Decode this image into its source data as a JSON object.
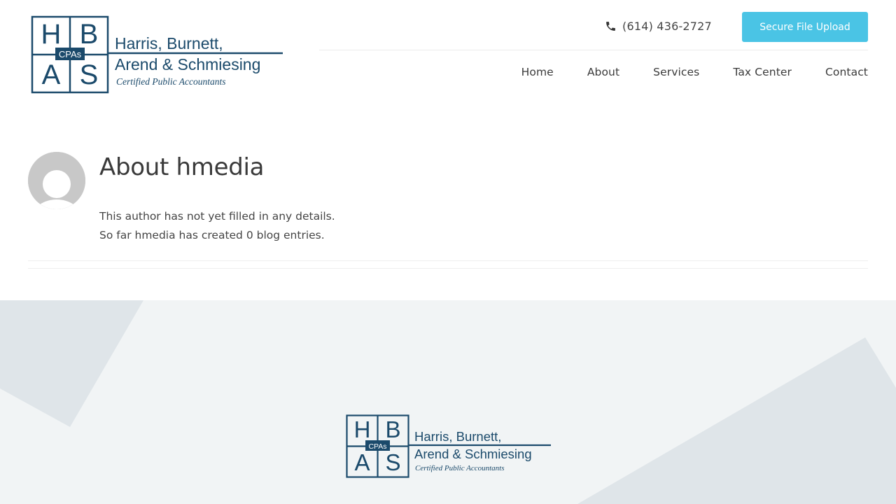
{
  "header": {
    "logo": {
      "letters": [
        "H",
        "B",
        "A",
        "S"
      ],
      "badge": "CPAs",
      "name_line1": "Harris, Burnett,",
      "name_line2": "Arend & Schmiesing",
      "tagline": "Certified Public Accountants"
    },
    "phone": "(614) 436-2727",
    "upload_label": "Secure File Upload",
    "nav": [
      "Home",
      "About",
      "Services",
      "Tax Center",
      "Contact"
    ]
  },
  "author": {
    "title": "About hmedia",
    "line1": "This author has not yet filled in any details.",
    "line2": "So far hmedia has created 0 blog entries."
  },
  "footer": {
    "logo": {
      "letters": [
        "H",
        "B",
        "A",
        "S"
      ],
      "badge": "CPAs",
      "name_line1": "Harris, Burnett,",
      "name_line2": "Arend & Schmiesing",
      "tagline": "Certified Public Accountants"
    }
  },
  "colors": {
    "brand": "#1b4a6b",
    "accent": "#4ac4e5",
    "footer_bg": "#f1f4f5",
    "footer_shape": "#dfe5e9",
    "avatar": "#c8c8c8"
  }
}
